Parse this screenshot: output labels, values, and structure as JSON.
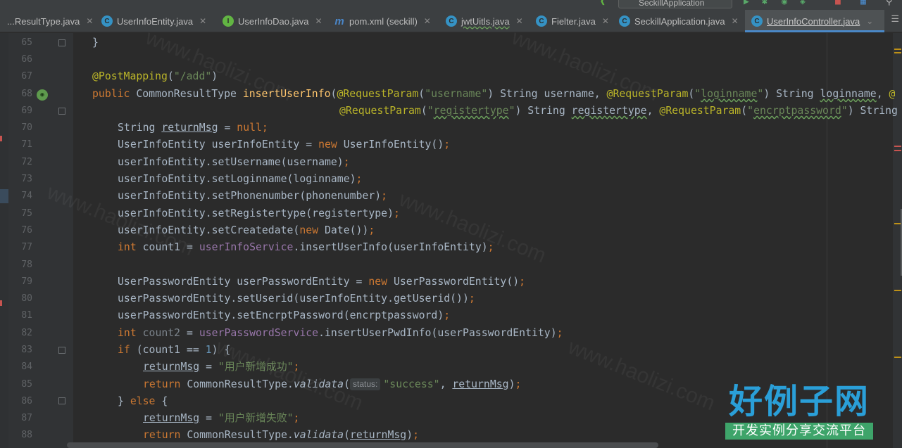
{
  "toolbar": {
    "run_config": "SeckillApplication"
  },
  "tabs": [
    {
      "label": "...ResultType.java",
      "icon": "class-icon",
      "icon_text": "C",
      "color": "#3592c4"
    },
    {
      "label": "UserInfoEntity.java",
      "icon": "class-icon",
      "icon_text": "C",
      "color": "#3592c4"
    },
    {
      "label": "UserInfoDao.java",
      "icon": "interface-icon",
      "icon_text": "I",
      "color": "#62b543"
    },
    {
      "label": "pom.xml (seckill)",
      "icon": "maven-icon",
      "icon_text": "m",
      "color": "#4a86c8"
    },
    {
      "label": "jwtUitls.java",
      "icon": "class-icon",
      "icon_text": "C",
      "color": "#3592c4"
    },
    {
      "label": "Fielter.java",
      "icon": "class-icon",
      "icon_text": "C",
      "color": "#3592c4"
    },
    {
      "label": "SeckillApplication.java",
      "icon": "spring-app-icon",
      "icon_text": "C",
      "color": "#3592c4"
    },
    {
      "label": "UserInfoController.java",
      "icon": "class-icon",
      "icon_text": "C",
      "color": "#3592c4",
      "active": true
    }
  ],
  "colors": {
    "background": "#2b2b2b",
    "keyword": "#cc7832",
    "string": "#6a8759",
    "annotation": "#bbb529",
    "method": "#ffc66d",
    "field": "#9876aa",
    "text": "#a9b7c6",
    "accent": "#4a88c7"
  },
  "lines": [
    {
      "n": "65",
      "code": "}"
    },
    {
      "n": "66",
      "code": ""
    },
    {
      "n": "67",
      "code": "@PostMapping(\"/add\")"
    },
    {
      "n": "68",
      "code": "public CommonResultType insertUserInfo(@RequestParam(\"username\") String username, @RequestParam(\"loginname\") String loginname, @"
    },
    {
      "n": "69",
      "code": "@RequestParam(\"registertype\") String registertype, @RequestParam(\"encrptpassword\") String"
    },
    {
      "n": "70",
      "code": "String returnMsg = null;"
    },
    {
      "n": "71",
      "code": "UserInfoEntity userInfoEntity = new UserInfoEntity();"
    },
    {
      "n": "72",
      "code": "userInfoEntity.setUsername(username);"
    },
    {
      "n": "73",
      "code": "userInfoEntity.setLoginname(loginname);"
    },
    {
      "n": "74",
      "code": "userInfoEntity.setPhonenumber(phonenumber);"
    },
    {
      "n": "75",
      "code": "userInfoEntity.setRegistertype(registertype);"
    },
    {
      "n": "76",
      "code": "userInfoEntity.setCreatedate(new Date());"
    },
    {
      "n": "77",
      "code": "int count1 = userInfoService.insertUserInfo(userInfoEntity);"
    },
    {
      "n": "78",
      "code": ""
    },
    {
      "n": "79",
      "code": "UserPasswordEntity userPasswordEntity = new UserPasswordEntity();"
    },
    {
      "n": "80",
      "code": "userPasswordEntity.setUserid(userInfoEntity.getUserid());"
    },
    {
      "n": "81",
      "code": "userPasswordEntity.setEncrptPassword(encrptpassword);"
    },
    {
      "n": "82",
      "code": "int count2 = userPasswordService.insertUserPwdInfo(userPasswordEntity);"
    },
    {
      "n": "83",
      "code": "if (count1 == 1) {"
    },
    {
      "n": "84",
      "code": "returnMsg = \"用户新增成功\";"
    },
    {
      "n": "85",
      "code": "return CommonResultType.validata(status: \"success\", returnMsg);"
    },
    {
      "n": "86",
      "code": "} else {"
    },
    {
      "n": "87",
      "code": "returnMsg = \"用户新增失败\";"
    },
    {
      "n": "88",
      "code": "return CommonResultType.validata(returnMsg);"
    }
  ],
  "watermark": {
    "text": "www.haolizi.com",
    "logo_main": "好例子网",
    "logo_sub": "开发实例分享交流平台"
  }
}
